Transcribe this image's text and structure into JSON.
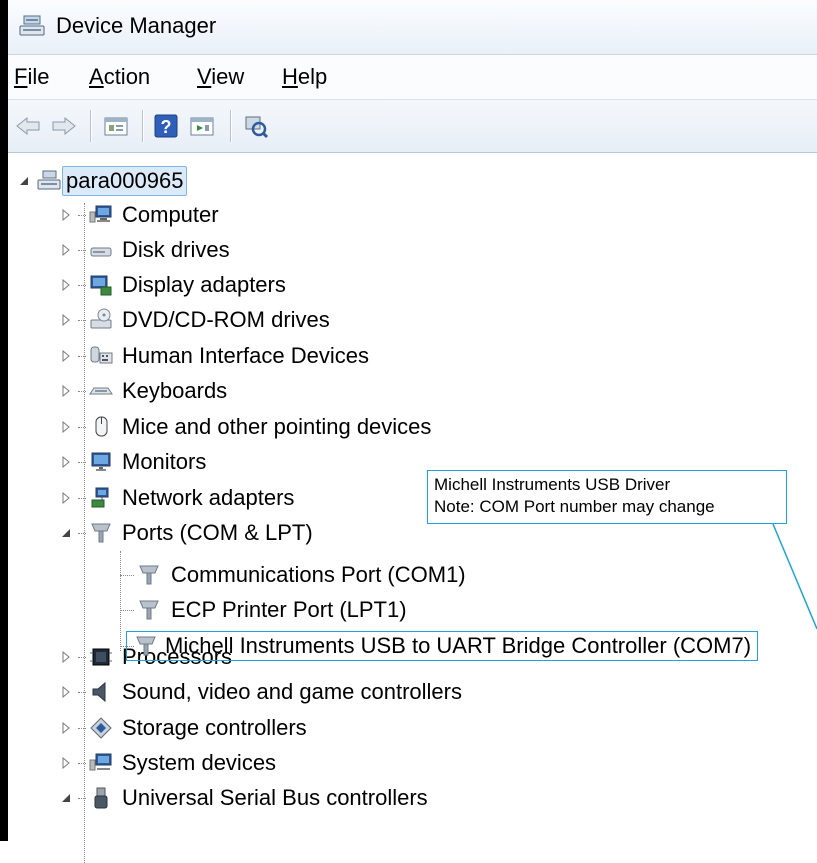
{
  "window": {
    "title": "Device Manager"
  },
  "menu": [
    {
      "label": "File",
      "key": "F",
      "rest": "ile"
    },
    {
      "label": "Action",
      "key": "A",
      "rest": "ction"
    },
    {
      "label": "View",
      "key": "V",
      "rest": "iew"
    },
    {
      "label": "Help",
      "key": "H",
      "rest": "elp"
    }
  ],
  "toolbar": {
    "back": "back-arrow-icon",
    "forward": "forward-arrow-icon",
    "properties": "properties-icon",
    "help": "help-icon",
    "help_glyph": "?",
    "update": "update-driver-icon",
    "scan": "scan-hardware-icon"
  },
  "tree": {
    "root": "para000965",
    "categories": [
      {
        "label": "Computer",
        "icon": "computer-icon",
        "expanded": false
      },
      {
        "label": "Disk drives",
        "icon": "disk-drive-icon",
        "expanded": false
      },
      {
        "label": "Display adapters",
        "icon": "display-adapter-icon",
        "expanded": false
      },
      {
        "label": "DVD/CD-ROM drives",
        "icon": "dvd-drive-icon",
        "expanded": false
      },
      {
        "label": "Human Interface Devices",
        "icon": "hid-icon",
        "expanded": false
      },
      {
        "label": "Keyboards",
        "icon": "keyboard-icon",
        "expanded": false
      },
      {
        "label": "Mice and other pointing devices",
        "icon": "mouse-icon",
        "expanded": false
      },
      {
        "label": "Monitors",
        "icon": "monitor-icon",
        "expanded": false
      },
      {
        "label": "Network adapters",
        "icon": "network-adapter-icon",
        "expanded": false
      },
      {
        "label": "Ports (COM & LPT)",
        "icon": "port-icon",
        "expanded": true
      },
      {
        "label": "Processors",
        "icon": "processor-icon",
        "expanded": false
      },
      {
        "label": "Sound, video and game controllers",
        "icon": "sound-icon",
        "expanded": false
      },
      {
        "label": "Storage controllers",
        "icon": "storage-icon",
        "expanded": false
      },
      {
        "label": "System devices",
        "icon": "system-devices-icon",
        "expanded": false
      },
      {
        "label": "Universal Serial Bus controllers",
        "icon": "usb-icon",
        "expanded": true
      }
    ],
    "ports_children": [
      "Communications Port (COM1)",
      "ECP Printer Port (LPT1)",
      "Michell Instruments USB to UART Bridge Controller (COM7)"
    ]
  },
  "callout": {
    "line1": "Michell Instruments USB Driver",
    "line2": "Note: COM Port number may change"
  },
  "colors": {
    "highlight_border": "#1fa3d8",
    "root_selection": "#dbeaf8"
  }
}
